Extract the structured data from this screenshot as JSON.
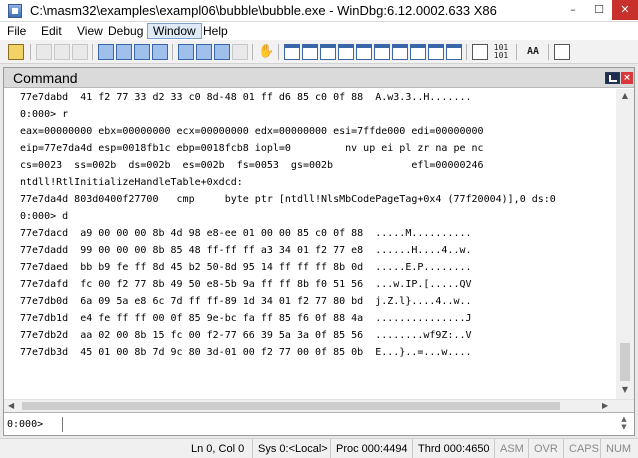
{
  "window": {
    "title": "C:\\masm32\\examples\\exampl06\\bubble\\bubble.exe - WinDbg:6.12.0002.633 X86",
    "minimize_glyph": "–",
    "maximize_glyph": "☐",
    "close_glyph": "✕"
  },
  "menu": [
    "File",
    "Edit",
    "View",
    "Debug",
    "Window",
    "Help"
  ],
  "menu_active": "Window",
  "toolbar": {
    "register_text": "101",
    "register_text2": "101",
    "font_text": "AA"
  },
  "command_window": {
    "title": "Command",
    "close_glyph": "×",
    "output_lines": [
      "77e7dabd  41 f2 77 33 d2 33 c0 8d-48 01 ff d6 85 c0 0f 88  A.w3.3..H.......",
      "0:000> r",
      "eax=00000000 ebx=00000000 ecx=00000000 edx=00000000 esi=7ffde000 edi=00000000",
      "eip=77e7da4d esp=0018fb1c ebp=0018fcb8 iopl=0         nv up ei pl zr na pe nc",
      "cs=0023  ss=002b  ds=002b  es=002b  fs=0053  gs=002b             efl=00000246",
      "ntdll!RtlInitializeHandleTable+0xdcd:",
      "77e7da4d 803d0400f27700   cmp     byte ptr [ntdll!NlsMbCodePageTag+0x4 (77f20004)],0 ds:0",
      "0:000> d",
      "77e7dacd  a9 00 00 00 8b 4d 98 e8-ee 01 00 00 85 c0 0f 88  .....M..........",
      "77e7dadd  99 00 00 00 8b 85 48 ff-ff ff a3 34 01 f2 77 e8  ......H....4..w.",
      "77e7daed  bb b9 fe ff 8d 45 b2 50-8d 95 14 ff ff ff 8b 0d  .....E.P........",
      "77e7dafd  fc 00 f2 77 8b 49 50 e8-5b 9a ff ff 8b f0 51 56  ...w.IP.[.....QV",
      "77e7db0d  6a 09 5a e8 6c 7d ff ff-89 1d 34 01 f2 77 80 bd  j.Z.l}....4..w..",
      "77e7db1d  e4 fe ff ff 00 0f 85 9e-bc fa ff 85 f6 0f 88 4a  ...............J",
      "77e7db2d  aa 02 00 8b 15 fc 00 f2-77 66 39 5a 3a 0f 85 56  ........wf9Z:..V",
      "77e7db3d  45 01 00 8b 7d 9c 80 3d-01 00 f2 77 00 0f 85 0b  E...}..=...w...."
    ],
    "prompt": "0:000>",
    "input_value": "",
    "scroll_up": "▲",
    "scroll_down": "▼",
    "scroll_left": "◀",
    "scroll_right": "▶"
  },
  "statusbar": {
    "position": "Ln 0, Col 0",
    "sys": "Sys 0:<Local>",
    "proc": "Proc 000:4494",
    "thrd": "Thrd 000:4650",
    "asm": "ASM",
    "ovr": "OVR",
    "caps": "CAPS",
    "num": "NUM"
  }
}
